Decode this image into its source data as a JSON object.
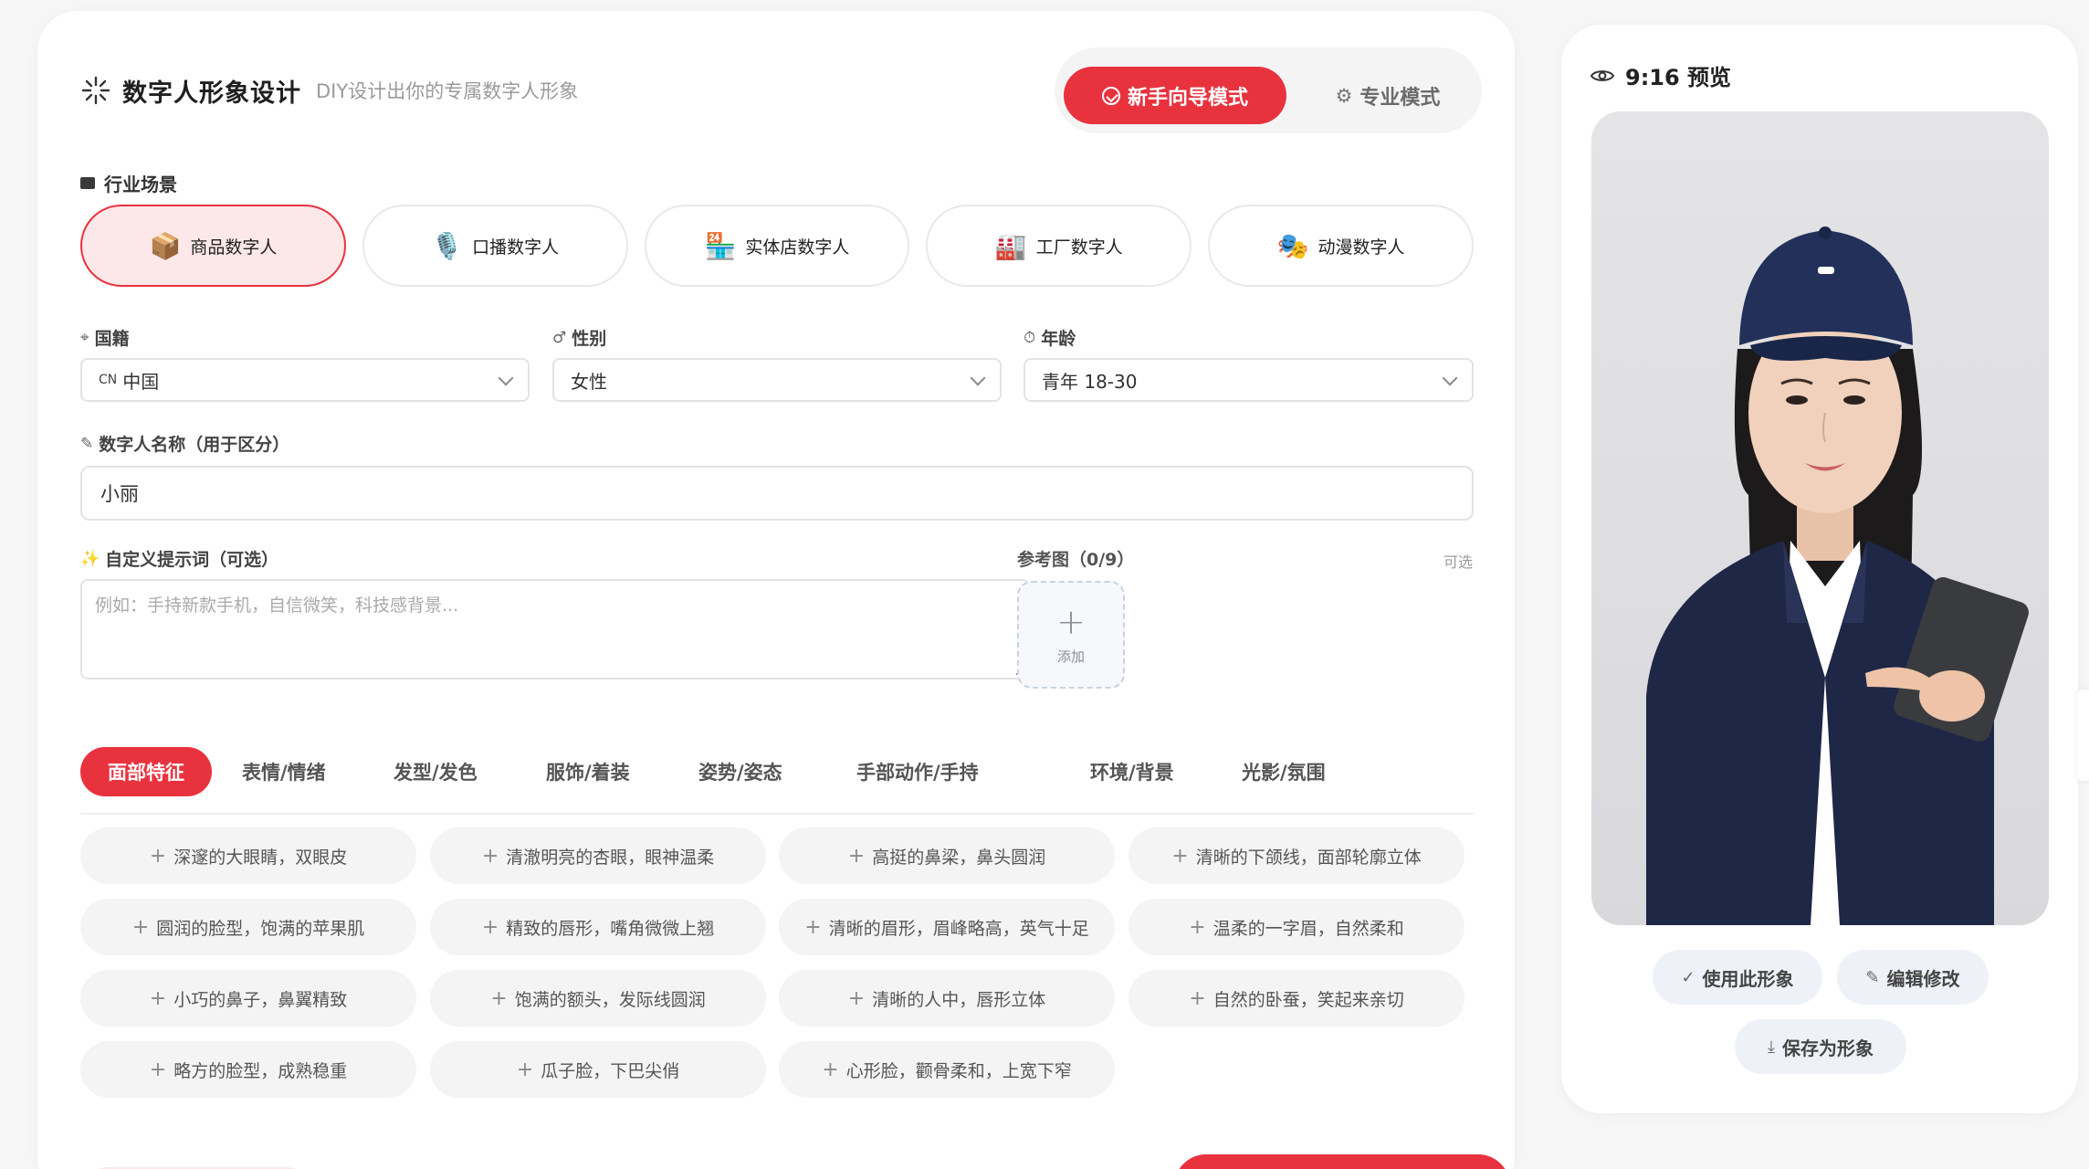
{
  "header": {
    "title": "数字人形象设计",
    "subtitle": "DIY设计出你的专属数字人形象",
    "mode_beginner": "新手向导模式",
    "mode_pro": "专业模式"
  },
  "industry": {
    "label": "行业场景",
    "cards": [
      {
        "label": "商品数字人",
        "icon": "📦",
        "active": true
      },
      {
        "label": "口播数字人",
        "icon": "🎙️",
        "active": false
      },
      {
        "label": "实体店数字人",
        "icon": "🏪",
        "active": false
      },
      {
        "label": "工厂数字人",
        "icon": "🏭",
        "active": false
      },
      {
        "label": "动漫数字人",
        "icon": "🎭",
        "active": false
      }
    ]
  },
  "fields": {
    "nationality_label": "国籍",
    "nationality_code": "CN",
    "nationality_value": "中国",
    "gender_label": "性别",
    "gender_value": "女性",
    "age_label": "年龄",
    "age_value": "青年 18-30",
    "name_label": "数字人名称（用于区分）",
    "name_value": "小丽",
    "prompt_label": "自定义提示词（可选）",
    "prompt_placeholder": "例如：手持新款手机，自信微笑，科技感背景...",
    "ref_label": "参考图（0/9）",
    "ref_optional": "可选",
    "ref_add": "添加"
  },
  "tabs": [
    "面部特征",
    "表情/情绪",
    "发型/发色",
    "服饰/着装",
    "姿势/姿态",
    "手部动作/手持",
    "环境/背景",
    "光影/氛围"
  ],
  "active_tab": "面部特征",
  "chips": [
    "深邃的大眼睛，双眼皮",
    "清澈明亮的杏眼，眼神温柔",
    "高挺的鼻梁，鼻头圆润",
    "清晰的下颌线，面部轮廓立体",
    "圆润的脸型，饱满的苹果肌",
    "精致的唇形，嘴角微微上翘",
    "清晰的眉形，眉峰略高，英气十足",
    "温柔的一字眉，自然柔和",
    "小巧的鼻子，鼻翼精致",
    "饱满的额头，发际线圆润",
    "清晰的人中，唇形立体",
    "自然的卧蚕，笑起来亲切",
    "略方的脸型，成熟稳重",
    "瓜子脸，下巴尖俏",
    "心形脸，颧骨柔和，上宽下窄"
  ],
  "preview": {
    "title": "9:16 预览",
    "use_label": "使用此形象",
    "edit_label": "编辑修改",
    "save_label": "保存为形象"
  },
  "colors": {
    "accent": "#e8333f",
    "accent_light": "#fde8e9"
  }
}
